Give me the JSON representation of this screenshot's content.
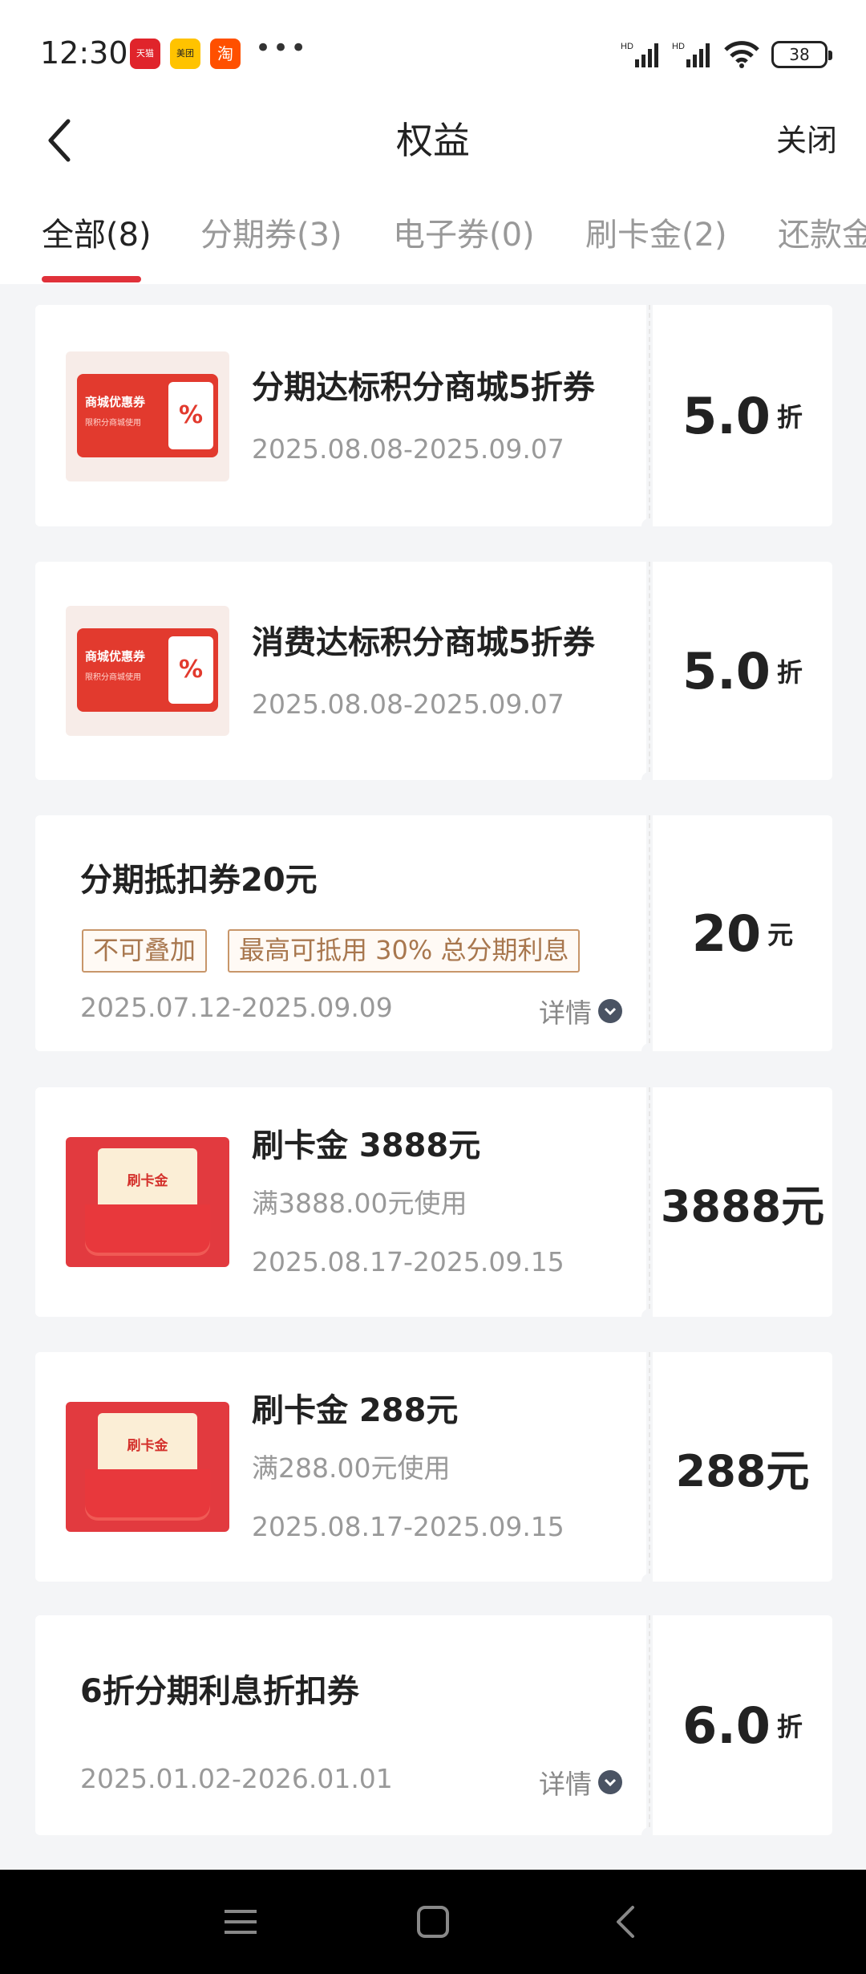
{
  "status": {
    "time": "12:30",
    "apps": [
      "天猫",
      "美团",
      "淘"
    ],
    "more": "•••",
    "battery": "38",
    "signal1": "HD",
    "signal2": "HD"
  },
  "header": {
    "title": "权益",
    "close_label": "关闭"
  },
  "tabs": [
    {
      "label": "全部(8)",
      "active": true
    },
    {
      "label": "分期券(3)",
      "active": false
    },
    {
      "label": "电子券(0)",
      "active": false
    },
    {
      "label": "刷卡金(2)",
      "active": false
    },
    {
      "label": "还款金",
      "active": false
    }
  ],
  "cards": [
    {
      "title": "分期达标积分商城5折券",
      "date": "2025.08.08-2025.09.07",
      "value": "5.0",
      "unit": "折",
      "thumb_title": "商城优惠券",
      "thumb_sub": "限积分商城使用"
    },
    {
      "title": "消费达标积分商城5折券",
      "date": "2025.08.08-2025.09.07",
      "value": "5.0",
      "unit": "折",
      "thumb_title": "商城优惠券",
      "thumb_sub": "限积分商城使用"
    },
    {
      "title": "分期抵扣券20元",
      "tag1": "不可叠加",
      "tag2": "最高可抵用 30% 总分期利息",
      "date": "2025.07.12-2025.09.09",
      "detail": "详情",
      "value": "20",
      "unit": "元"
    },
    {
      "title": "刷卡金 3888元",
      "sub": "满3888.00元使用",
      "date": "2025.08.17-2025.09.15",
      "value": "3888元",
      "thumb_title": "刷卡金"
    },
    {
      "title": "刷卡金 288元",
      "sub": "满288.00元使用",
      "date": "2025.08.17-2025.09.15",
      "value": "288元",
      "thumb_title": "刷卡金"
    },
    {
      "title": "6折分期利息折扣券",
      "date": "2025.01.02-2026.01.01",
      "detail": "详情",
      "value": "6.0",
      "unit": "折"
    }
  ],
  "colors": {
    "accent": "#e0313a",
    "tag_border": "#c8966a"
  }
}
